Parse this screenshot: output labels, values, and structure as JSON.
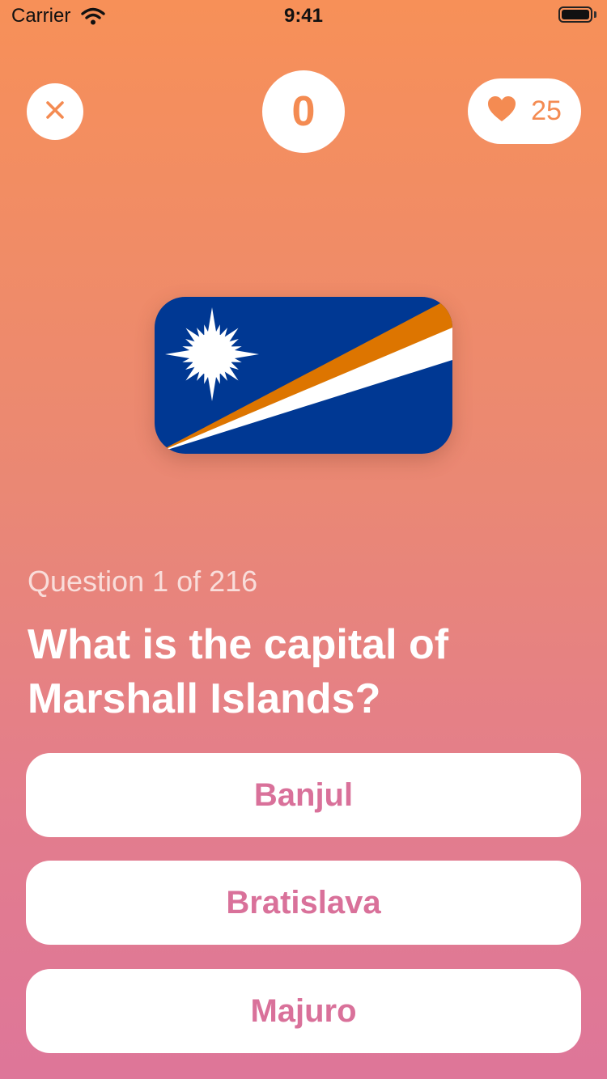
{
  "status_bar": {
    "carrier": "Carrier",
    "time": "9:41"
  },
  "header": {
    "score": "0",
    "lives": "25",
    "colors": {
      "accent": "#f48b52",
      "answer_text": "#d9719a"
    }
  },
  "flag": {
    "icon": "marshall-islands-flag"
  },
  "question": {
    "progress": "Question 1 of 216",
    "text": "What is the capital of Marshall Islands?"
  },
  "answers": [
    {
      "label": "Banjul"
    },
    {
      "label": "Bratislava"
    },
    {
      "label": "Majuro"
    }
  ]
}
